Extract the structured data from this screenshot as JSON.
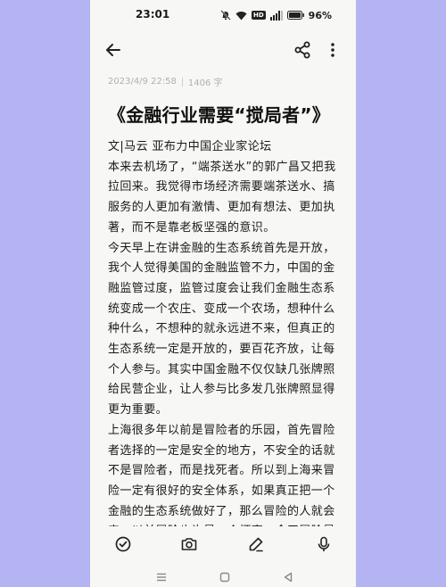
{
  "status_bar": {
    "time": "23:01",
    "network_badge": "HD",
    "battery": "96%"
  },
  "header": {
    "back_icon": "arrow-left-icon",
    "share_icon": "share-icon",
    "more_icon": "more-vertical-icon"
  },
  "note": {
    "date": "2023/4/9 22:58",
    "word_count": "1406 字",
    "title": "《金融行业需要“搅局者”》",
    "paragraphs": [
      "文|马云 亚布力中国企业家论坛",
      "本来去机场了，“端茶送水”的郭广昌又把我拉回来。我觉得市场经济需要端茶送水、搞服务的人更加有激情、更加有想法、更加执著，而不是靠老板坚强的意识。",
      "今天早上在讲金融的生态系统首先是开放，我个人觉得美国的金融监管不力，中国的金融监管过度，监管过度会让我们金融生态系统变成一个农庄、变成一个农场，想种什么种什么，不想种的就永远进不来，但真正的生态系统一定是开放的，要百花齐放，让每个人参与。其实中国金融不仅仅缺几张牌照给民营企业，让人参与比多发几张牌照显得更为重要。",
      "上海很多年以前是冒险者的乐园，首先冒险者选择的一定是安全的地方，不安全的话就不是冒险者，而是找死者。所以到上海来冒险一定有很好的安全体系，如果真正把一个金融的生态系统做好了，那么冒险的人就会来。以前冒险也许是一个坏事，今天冒险是"
    ]
  },
  "toolbar": {
    "items": [
      "checklist-icon",
      "camera-icon",
      "pen-icon",
      "microphone-icon"
    ]
  },
  "nav": {
    "items": [
      "menu-icon",
      "home-icon",
      "back-triangle-icon"
    ]
  }
}
